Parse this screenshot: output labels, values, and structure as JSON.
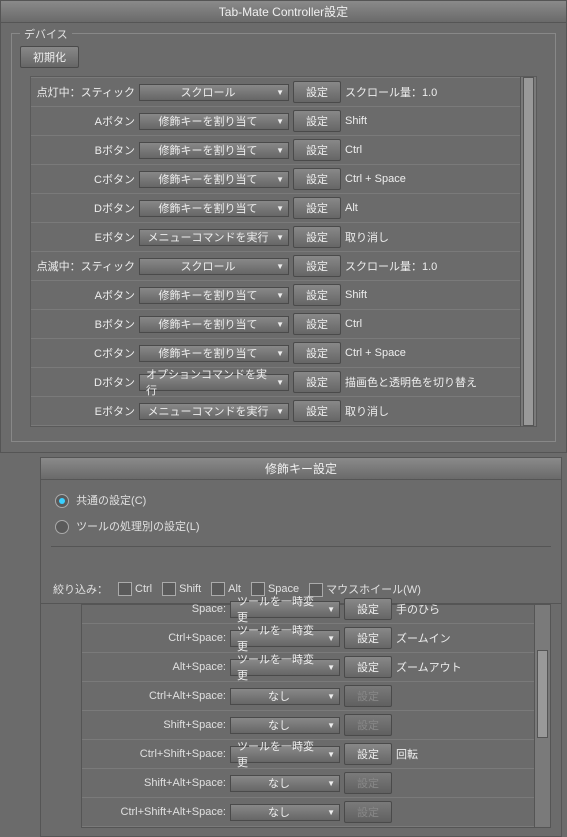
{
  "panel1": {
    "title": "Tab-Mate Controller設定",
    "group": "デバイス",
    "init_btn": "初期化",
    "settings_btn": "設定",
    "scroll_prefix": "スクロール量：",
    "sections": {
      "lit": {
        "header": "点灯中：スティック"
      },
      "blink": {
        "header": "点滅中：スティック"
      }
    },
    "labels": {
      "a": "Aボタン",
      "b": "Bボタン",
      "c": "Cボタン",
      "d": "Dボタン",
      "e": "Eボタン"
    },
    "actions": {
      "scroll": "スクロール",
      "assign_mod": "修飾キーを割り当て",
      "exec_menu": "メニューコマンドを実行",
      "exec_option": "オプションコマンドを実行"
    },
    "rows_lit": {
      "stick": {
        "action_key": "scroll",
        "value": "1.0"
      },
      "a": {
        "value": "Shift"
      },
      "b": {
        "value": "Ctrl"
      },
      "c": {
        "value": "Ctrl + Space"
      },
      "d": {
        "value": "Alt"
      },
      "e": {
        "action_key": "exec_menu",
        "value": "取り消し"
      }
    },
    "rows_blink": {
      "stick": {
        "action_key": "scroll",
        "value": "1.0"
      },
      "a": {
        "value": "Shift"
      },
      "b": {
        "value": "Ctrl"
      },
      "c": {
        "value": "Ctrl + Space"
      },
      "d": {
        "action_key": "exec_option",
        "value": "描画色と透明色を切り替え"
      },
      "e": {
        "action_key": "exec_menu",
        "value": "取り消し"
      }
    }
  },
  "panel2": {
    "title": "修飾キー設定",
    "radio_common": "共通の設定(C)",
    "radio_tool": "ツールの処理別の設定(L)",
    "filter_label": "絞り込み：",
    "filter": {
      "ctrl": "Ctrl",
      "shift": "Shift",
      "alt": "Alt",
      "space": "Space",
      "wheel": "マウスホイール(W)"
    },
    "settings_btn": "設定",
    "drop_values": {
      "temp": "ツールを一時変更",
      "none": "なし"
    },
    "rows": [
      {
        "label": "Space:",
        "drop": "temp",
        "value": "手のひら",
        "enabled": true,
        "cut": true
      },
      {
        "label": "Ctrl+Space:",
        "drop": "temp",
        "value": "ズームイン",
        "enabled": true
      },
      {
        "label": "Alt+Space:",
        "drop": "temp",
        "value": "ズームアウト",
        "enabled": true
      },
      {
        "label": "Ctrl+Alt+Space:",
        "drop": "none",
        "value": "",
        "enabled": false
      },
      {
        "label": "Shift+Space:",
        "drop": "none",
        "value": "",
        "enabled": false
      },
      {
        "label": "Ctrl+Shift+Space:",
        "drop": "temp",
        "value": "回転",
        "enabled": true
      },
      {
        "label": "Shift+Alt+Space:",
        "drop": "none",
        "value": "",
        "enabled": false
      },
      {
        "label": "Ctrl+Shift+Alt+Space:",
        "drop": "none",
        "value": "",
        "enabled": false
      }
    ]
  }
}
